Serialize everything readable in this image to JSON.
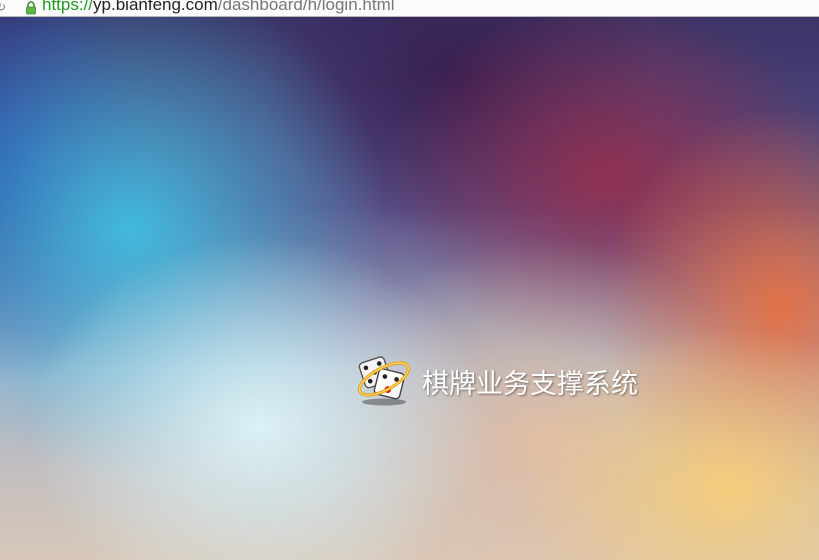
{
  "browser": {
    "url_scheme": "https://",
    "url_host": "yp.bianfeng.com",
    "url_path": "/dashboard/h/login.html"
  },
  "page": {
    "title": "棋牌业务支撑系统",
    "logo_icon": "dice-logo-icon"
  }
}
